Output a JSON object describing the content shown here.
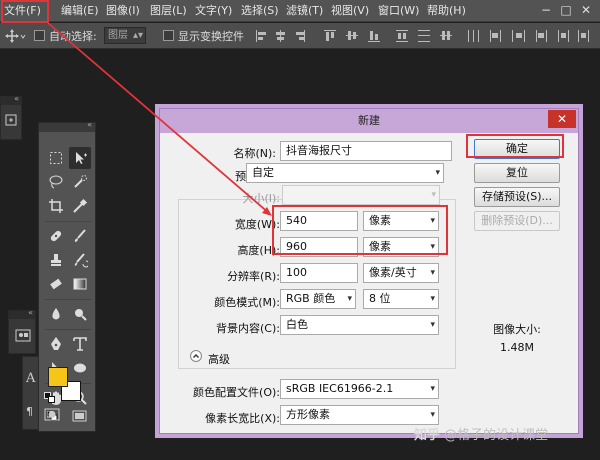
{
  "menubar": {
    "file": "文件(F)",
    "edit": "编辑(E)",
    "image": "图像(I)",
    "layer": "图层(L)",
    "type": "文字(Y)",
    "select": "选择(S)",
    "filter": "滤镜(T)",
    "view": "视图(V)",
    "window": "窗口(W)",
    "help": "帮助(H)"
  },
  "options": {
    "auto_select": "自动选择:",
    "auto_select_value": "图层",
    "show_transform": "显示变换控件"
  },
  "dialog": {
    "title": "新建",
    "name_label": "名称(N):",
    "name_value": "抖音海报尺寸",
    "preset_label": "预设(P):",
    "preset_value": "自定",
    "size_label": "大小(I):",
    "width_label": "宽度(W):",
    "width_value": "540",
    "width_unit": "像素",
    "height_label": "高度(H):",
    "height_value": "960",
    "height_unit": "像素",
    "resolution_label": "分辨率(R):",
    "resolution_value": "100",
    "resolution_unit": "像素/英寸",
    "color_mode_label": "颜色模式(M):",
    "color_mode_value": "RGB 颜色",
    "bit_depth_value": "8 位",
    "background_label": "背景内容(C):",
    "background_value": "白色",
    "advanced_label": "高级",
    "color_profile_label": "颜色配置文件(O):",
    "color_profile_value": "sRGB IEC61966-2.1",
    "pixel_aspect_label": "像素长宽比(X):",
    "pixel_aspect_value": "方形像素",
    "ok_button": "确定",
    "reset_button": "复位",
    "save_preset_button": "存储预设(S)...",
    "delete_preset_button": "删除预设(D)...",
    "image_size_label": "图像大小:",
    "image_size_value": "1.48M"
  },
  "watermark": {
    "brand": "知乎",
    "author": "@格子的设计课堂"
  },
  "colors": {
    "annotation_red": "#e0343a",
    "foreground_swatch": "#f5c518",
    "background_swatch": "#ffffff",
    "dialog_title_bg": "#c7a6d8"
  }
}
